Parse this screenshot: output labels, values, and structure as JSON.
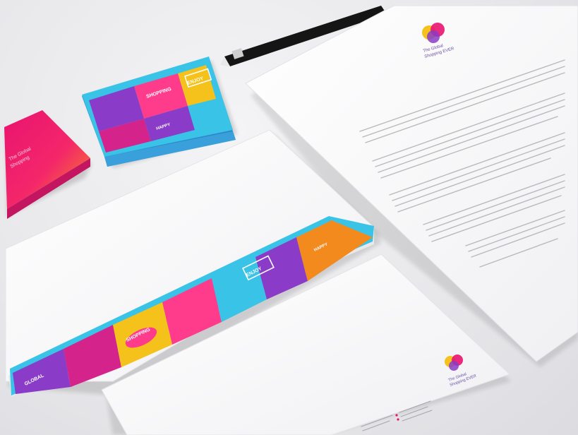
{
  "scene": {
    "subject": "stationery brand identity mockup",
    "colors": {
      "magenta": "#d4248c",
      "purple": "#8a3cc8",
      "orange": "#f28a1e",
      "yellow": "#f5c21b",
      "cyan": "#39c3e6",
      "pink": "#ff3c8c",
      "paper": "#fbfbfc"
    }
  },
  "business_card": {
    "lines": [
      "The Global",
      "Shopping"
    ]
  },
  "card_stack": {
    "labels": [
      "SHOPPING",
      "ENJOY",
      "HAPPY"
    ]
  },
  "envelope_band": {
    "labels": [
      "GLOBAL",
      "SHOPPING",
      "ENJOY",
      "HAPPY"
    ]
  },
  "letterhead": {
    "brand_lines": [
      "The Global",
      "Shopping EVER"
    ]
  },
  "compliment_slip": {
    "brand_lines": [
      "The Global",
      "Shopping EVER"
    ]
  }
}
